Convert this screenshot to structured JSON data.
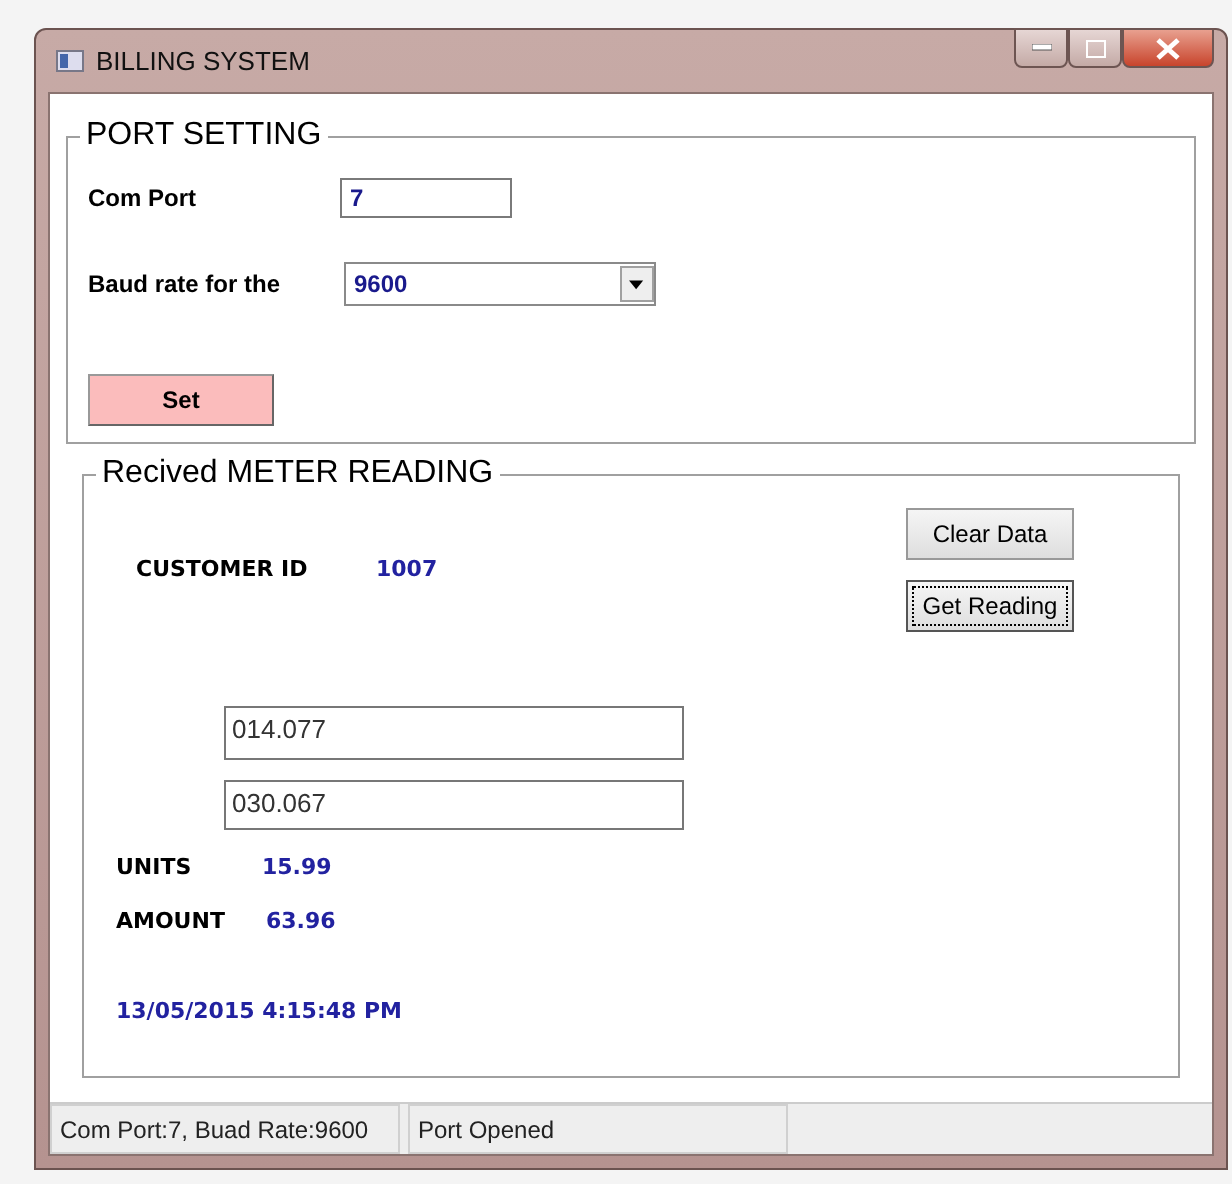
{
  "window": {
    "title": "BILLING SYSTEM"
  },
  "port_setting": {
    "title": "PORT SETTING",
    "com_port_label": "Com Port",
    "com_port_value": "7",
    "baud_label": "Baud rate for the",
    "baud_value": "9600",
    "set_button": "Set"
  },
  "meter_reading": {
    "title": "Recived METER READING",
    "clear_button": "Clear Data",
    "get_button": "Get Reading",
    "customer_id_label": "CUSTOMER ID",
    "customer_id": "1007",
    "reading_1": "014.077",
    "reading_2": "030.067",
    "units_label": "UNITS",
    "units": "15.99",
    "amount_label": "AMOUNT",
    "amount": "63.96",
    "timestamp": "13/05/2015 4:15:48 PM"
  },
  "status_bar": [
    "Com Port:7, Buad Rate:9600",
    "Port Opened"
  ]
}
